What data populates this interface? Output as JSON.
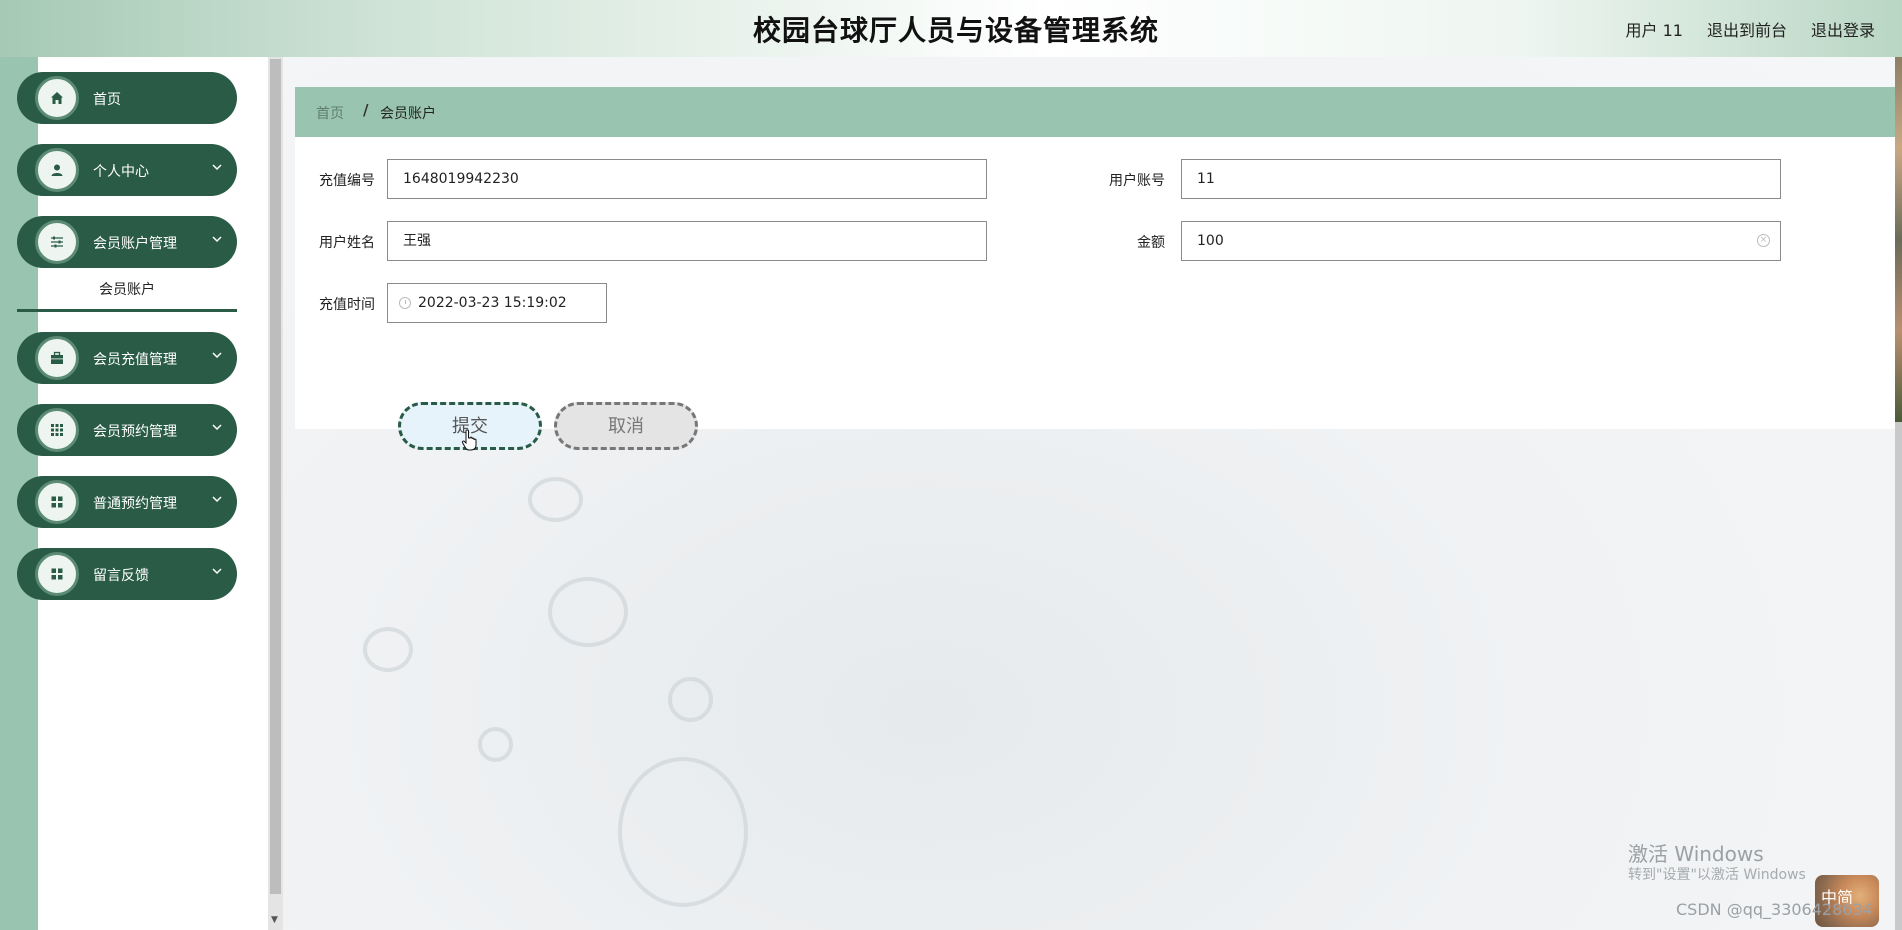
{
  "header": {
    "title": "校园台球厅人员与设备管理系统",
    "links": {
      "user": "用户 11",
      "to_front": "退出到前台",
      "logout": "退出登录"
    }
  },
  "sidebar": {
    "items": [
      {
        "label": "首页",
        "icon": "home-icon"
      },
      {
        "label": "个人中心",
        "icon": "user-icon"
      },
      {
        "label": "会员账户管理",
        "icon": "sliders-icon"
      },
      {
        "label": "会员充值管理",
        "icon": "briefcase-icon"
      },
      {
        "label": "会员预约管理",
        "icon": "grid-icon"
      },
      {
        "label": "普通预约管理",
        "icon": "grid-icon"
      },
      {
        "label": "留言反馈",
        "icon": "grid-icon"
      }
    ],
    "submenu": {
      "label": "会员账户"
    }
  },
  "breadcrumb": {
    "home": "首页",
    "separator": "/",
    "current": "会员账户"
  },
  "form": {
    "recharge_no": {
      "label": "充值编号",
      "value": "1648019942230"
    },
    "user_account": {
      "label": "用户账号",
      "value": "11"
    },
    "user_name": {
      "label": "用户姓名",
      "value": "王强"
    },
    "amount": {
      "label": "金额",
      "value": "100"
    },
    "recharge_time": {
      "label": "充值时间",
      "value": "2022-03-23 15:19:02"
    },
    "submit_label": "提交",
    "cancel_label": "取消"
  },
  "overlay": {
    "windows_activate": "激活 Windows",
    "windows_hint": "转到\"设置\"以激活 Windows",
    "csdn": "CSDN @qq_3306428634",
    "ime": "中简"
  },
  "colors": {
    "sidebar_button": "#2a5b47",
    "accent_green": "#99c5b0",
    "submit_bg": "#e6f3fb"
  }
}
